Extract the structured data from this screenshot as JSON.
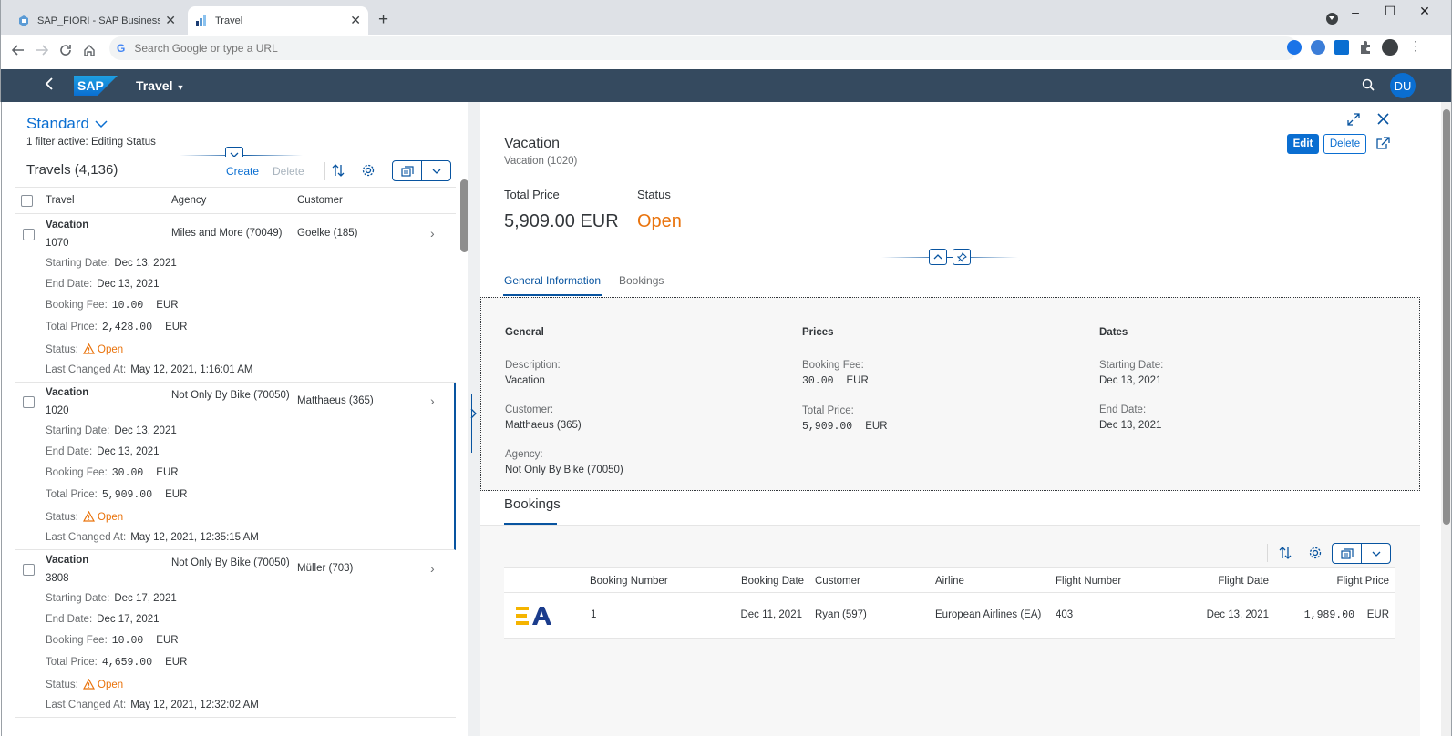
{
  "browser": {
    "tabs": [
      {
        "title": "SAP_FIORI - SAP Business Applic",
        "close": "✕"
      },
      {
        "title": "Travel",
        "close": "✕"
      }
    ],
    "new_tab": "+",
    "address_placeholder": "Search Google or type a URL"
  },
  "shell": {
    "logo": "SAP",
    "app_title": "Travel",
    "avatar": "DU"
  },
  "list": {
    "variant": "Standard",
    "filter_info": "1 filter active: Editing Status",
    "table_title": "Travels (4,136)",
    "create_label": "Create",
    "delete_label": "Delete",
    "columns": [
      "Travel",
      "Agency",
      "Customer"
    ],
    "field_labels": {
      "starting_date": "Starting Date:",
      "end_date": "End Date:",
      "booking_fee": "Booking Fee:",
      "total_price": "Total Price:",
      "status": "Status:",
      "last_changed": "Last Changed At:"
    },
    "rows": [
      {
        "title": "Vacation",
        "id": "1070",
        "agency": "Miles and More (70049)",
        "customer": "Goelke (185)",
        "starting_date": "Dec 13, 2021",
        "end_date": "Dec 13, 2021",
        "booking_fee": "10.00",
        "fee_currency": "EUR",
        "total_price": "2,428.00",
        "price_currency": "EUR",
        "status": "Open",
        "last_changed": "May 12, 2021, 1:16:01 AM"
      },
      {
        "title": "Vacation",
        "id": "1020",
        "agency": "Not Only By Bike (70050)",
        "customer": "Matthaeus (365)",
        "starting_date": "Dec 13, 2021",
        "end_date": "Dec 13, 2021",
        "booking_fee": "30.00",
        "fee_currency": "EUR",
        "total_price": "5,909.00",
        "price_currency": "EUR",
        "status": "Open",
        "last_changed": "May 12, 2021, 12:35:15 AM"
      },
      {
        "title": "Vacation",
        "id": "3808",
        "agency": "Not Only By Bike (70050)",
        "customer": "Müller (703)",
        "starting_date": "Dec 17, 2021",
        "end_date": "Dec 17, 2021",
        "booking_fee": "10.00",
        "fee_currency": "EUR",
        "total_price": "4,659.00",
        "price_currency": "EUR",
        "status": "Open",
        "last_changed": "May 12, 2021, 12:32:02 AM"
      }
    ]
  },
  "detail": {
    "title": "Vacation",
    "subtitle": "Vacation (1020)",
    "edit_label": "Edit",
    "delete_label": "Delete",
    "kpis": {
      "total_price_label": "Total Price",
      "total_price_value": "5,909.00 EUR",
      "status_label": "Status",
      "status_value": "Open"
    },
    "tabs": [
      "General Information",
      "Bookings"
    ],
    "general": {
      "title": "General",
      "description_label": "Description:",
      "description_value": "Vacation",
      "customer_label": "Customer:",
      "customer_value": "Matthaeus (365)",
      "agency_label": "Agency:",
      "agency_value": "Not Only By Bike (70050)"
    },
    "prices": {
      "title": "Prices",
      "booking_fee_label": "Booking Fee:",
      "booking_fee_value": "30.00",
      "booking_fee_currency": "EUR",
      "total_price_label": "Total Price:",
      "total_price_value": "5,909.00",
      "total_price_currency": "EUR"
    },
    "dates": {
      "title": "Dates",
      "starting_date_label": "Starting Date:",
      "starting_date_value": "Dec 13, 2021",
      "end_date_label": "End Date:",
      "end_date_value": "Dec 13, 2021"
    },
    "bookings": {
      "section_title": "Bookings",
      "columns": [
        "Booking Number",
        "Booking Date",
        "Customer",
        "Airline",
        "Flight Number",
        "Flight Date",
        "Flight Price"
      ],
      "rows": [
        {
          "booking_number": "1",
          "booking_date": "Dec 11, 2021",
          "customer": "Ryan (597)",
          "airline": "European Airlines (EA)",
          "flight_number": "403",
          "flight_date": "Dec 13, 2021",
          "flight_price": "1,989.00",
          "currency": "EUR"
        }
      ]
    }
  },
  "colors": {
    "shell_bg": "#354a5f",
    "brand_blue": "#0a6ed1",
    "selection_blue": "#0854a0",
    "status_open": "#e9730c",
    "avatar_bg": "#0a6ed1"
  }
}
